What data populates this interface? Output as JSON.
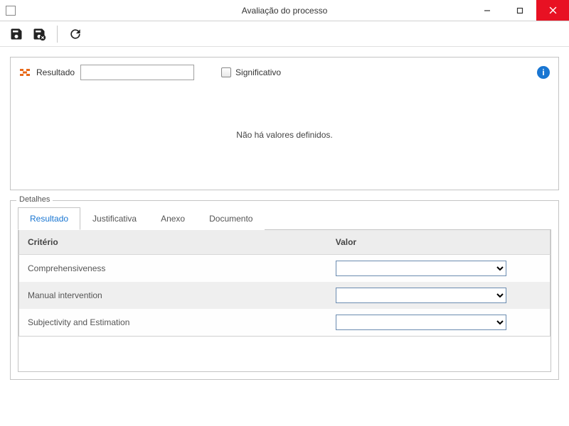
{
  "window": {
    "title": "Avaliação do processo"
  },
  "top": {
    "result_label": "Resultado",
    "result_value": "",
    "significative_label": "Significativo",
    "info_icon": "i"
  },
  "empty_message": "Não há valores definidos.",
  "details": {
    "legend": "Detalhes",
    "tabs": {
      "result": "Resultado",
      "justification": "Justificativa",
      "attachment": "Anexo",
      "document": "Documento"
    },
    "headers": {
      "criterion": "Critério",
      "value": "Valor"
    },
    "rows": [
      {
        "criterion": "Comprehensiveness",
        "value": ""
      },
      {
        "criterion": "Manual intervention",
        "value": ""
      },
      {
        "criterion": "Subjectivity and Estimation",
        "value": ""
      }
    ]
  }
}
